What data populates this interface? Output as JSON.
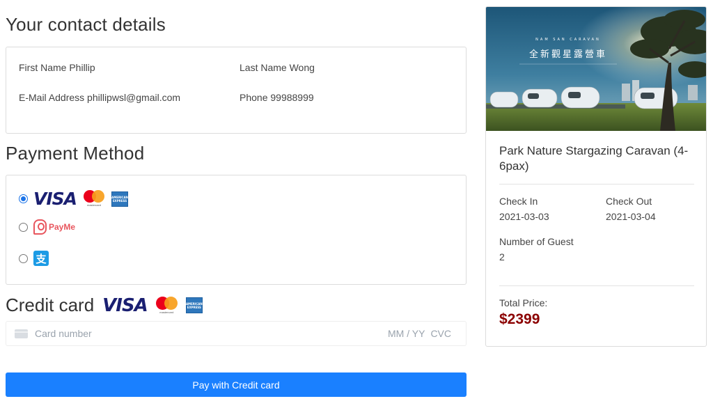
{
  "contact": {
    "title": "Your contact details",
    "first_name": "First Name Phillip",
    "last_name": "Last Name Wong",
    "email": "E-Mail Address phillipwsl@gmail.com",
    "phone": "Phone 99988999"
  },
  "payment": {
    "title": "Payment Method",
    "options": [
      {
        "name": "credit-card",
        "selected": true,
        "brands": [
          "VISA",
          "mastercard",
          "AMERICAN EXPRESS"
        ]
      },
      {
        "name": "payme",
        "selected": false,
        "label": "PayMe"
      },
      {
        "name": "alipay",
        "selected": false,
        "icon": "alipay-icon"
      }
    ]
  },
  "credit_card": {
    "title": "Credit card",
    "visa": "VISA",
    "mastercard_text": "mastercard",
    "amex_text": "AMERICAN EXPRESS",
    "placeholder": "Card number",
    "expiry_placeholder": "MM / YY",
    "cvc_placeholder": "CVC",
    "pay_button": "Pay with Credit card"
  },
  "booking": {
    "photo_title": "全新觀星露營車",
    "photo_caption": "NAM SAN CARAVAN",
    "product_title": "Park Nature Stargazing Caravan (4-6pax)",
    "check_in_label": "Check In",
    "check_in_value": "2021-03-03",
    "check_out_label": "Check Out",
    "check_out_value": "2021-03-04",
    "guests_label": "Number of Guest",
    "guests_value": "2",
    "total_label": "Total Price:",
    "total_value": "$2399"
  },
  "colors": {
    "accent": "#1a80ff",
    "price": "#8b0000",
    "payme": "#e8555d",
    "alipay": "#1c9be5"
  }
}
